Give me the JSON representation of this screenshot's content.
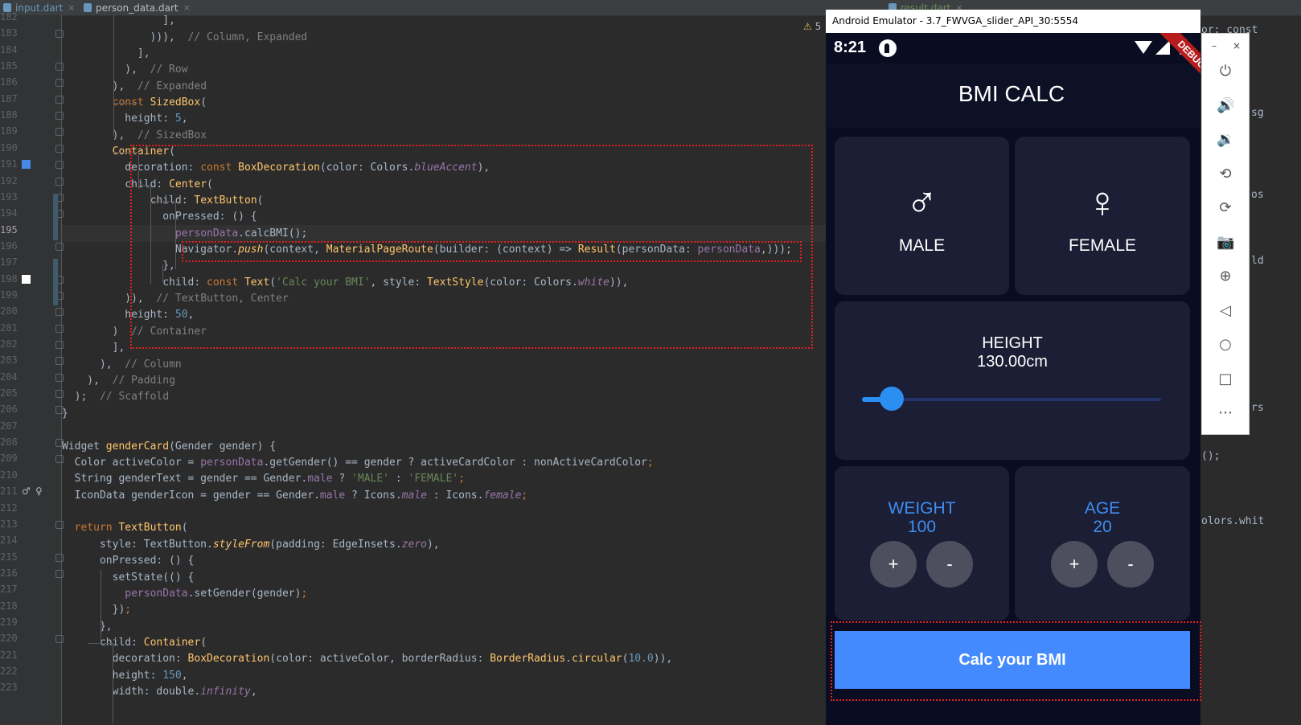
{
  "ide": {
    "tabs": [
      {
        "label": "input.dart"
      },
      {
        "label": "person_data.dart"
      },
      {
        "label": "result.dart"
      }
    ],
    "warning_count": "5",
    "line_numbers": [
      "182",
      "183",
      "184",
      "185",
      "186",
      "187",
      "188",
      "189",
      "190",
      "191",
      "192",
      "193",
      "194",
      "195",
      "196",
      "197",
      "198",
      "199",
      "200",
      "201",
      "202",
      "203",
      "204",
      "205",
      "206",
      "207",
      "208",
      "209",
      "210",
      "211",
      "212",
      "213",
      "214",
      "215",
      "216",
      "217",
      "218",
      "219",
      "220",
      "221",
      "222",
      "223"
    ],
    "behind_text": [
      "or: const",
      "sg",
      "os",
      "ld",
      "();",
      "olors.whit",
      "rs"
    ]
  },
  "emulator": {
    "window_title": "Android Emulator - 3.7_FWVGA_slider_API_30:5554",
    "status_time": "8:21",
    "debug_banner": "DEBUG",
    "app_title": "BMI CALC",
    "male_icon": "♂",
    "female_icon": "♀",
    "male_label": "MALE",
    "female_label": "FEMALE",
    "height_label": "HEIGHT",
    "height_value": "130.00cm",
    "height_slider_fraction": 0.1,
    "weight_label": "WEIGHT",
    "weight_value": "100",
    "age_label": "AGE",
    "age_value": "20",
    "plus": "+",
    "minus": "-",
    "calc_button": "Calc your BMI",
    "colors": {
      "background": "#0a0d22",
      "card": "#1b1e34",
      "accent_blue": "#448aff",
      "slider": "#2b8ff2"
    },
    "toolbar_icons": [
      "power-icon",
      "volume-up-icon",
      "volume-down-icon",
      "rotate-left-icon",
      "rotate-right-icon",
      "camera-icon",
      "zoom-icon",
      "back-icon",
      "home-icon",
      "overview-icon",
      "more-icon"
    ],
    "toolbar_glyphs": [
      "⏻",
      "🔊",
      "🔉",
      "⟲",
      "⟳",
      "📷",
      "⊕",
      "◁",
      "○",
      "□",
      "⋯"
    ],
    "window_minimize": "–",
    "window_close": "×"
  }
}
